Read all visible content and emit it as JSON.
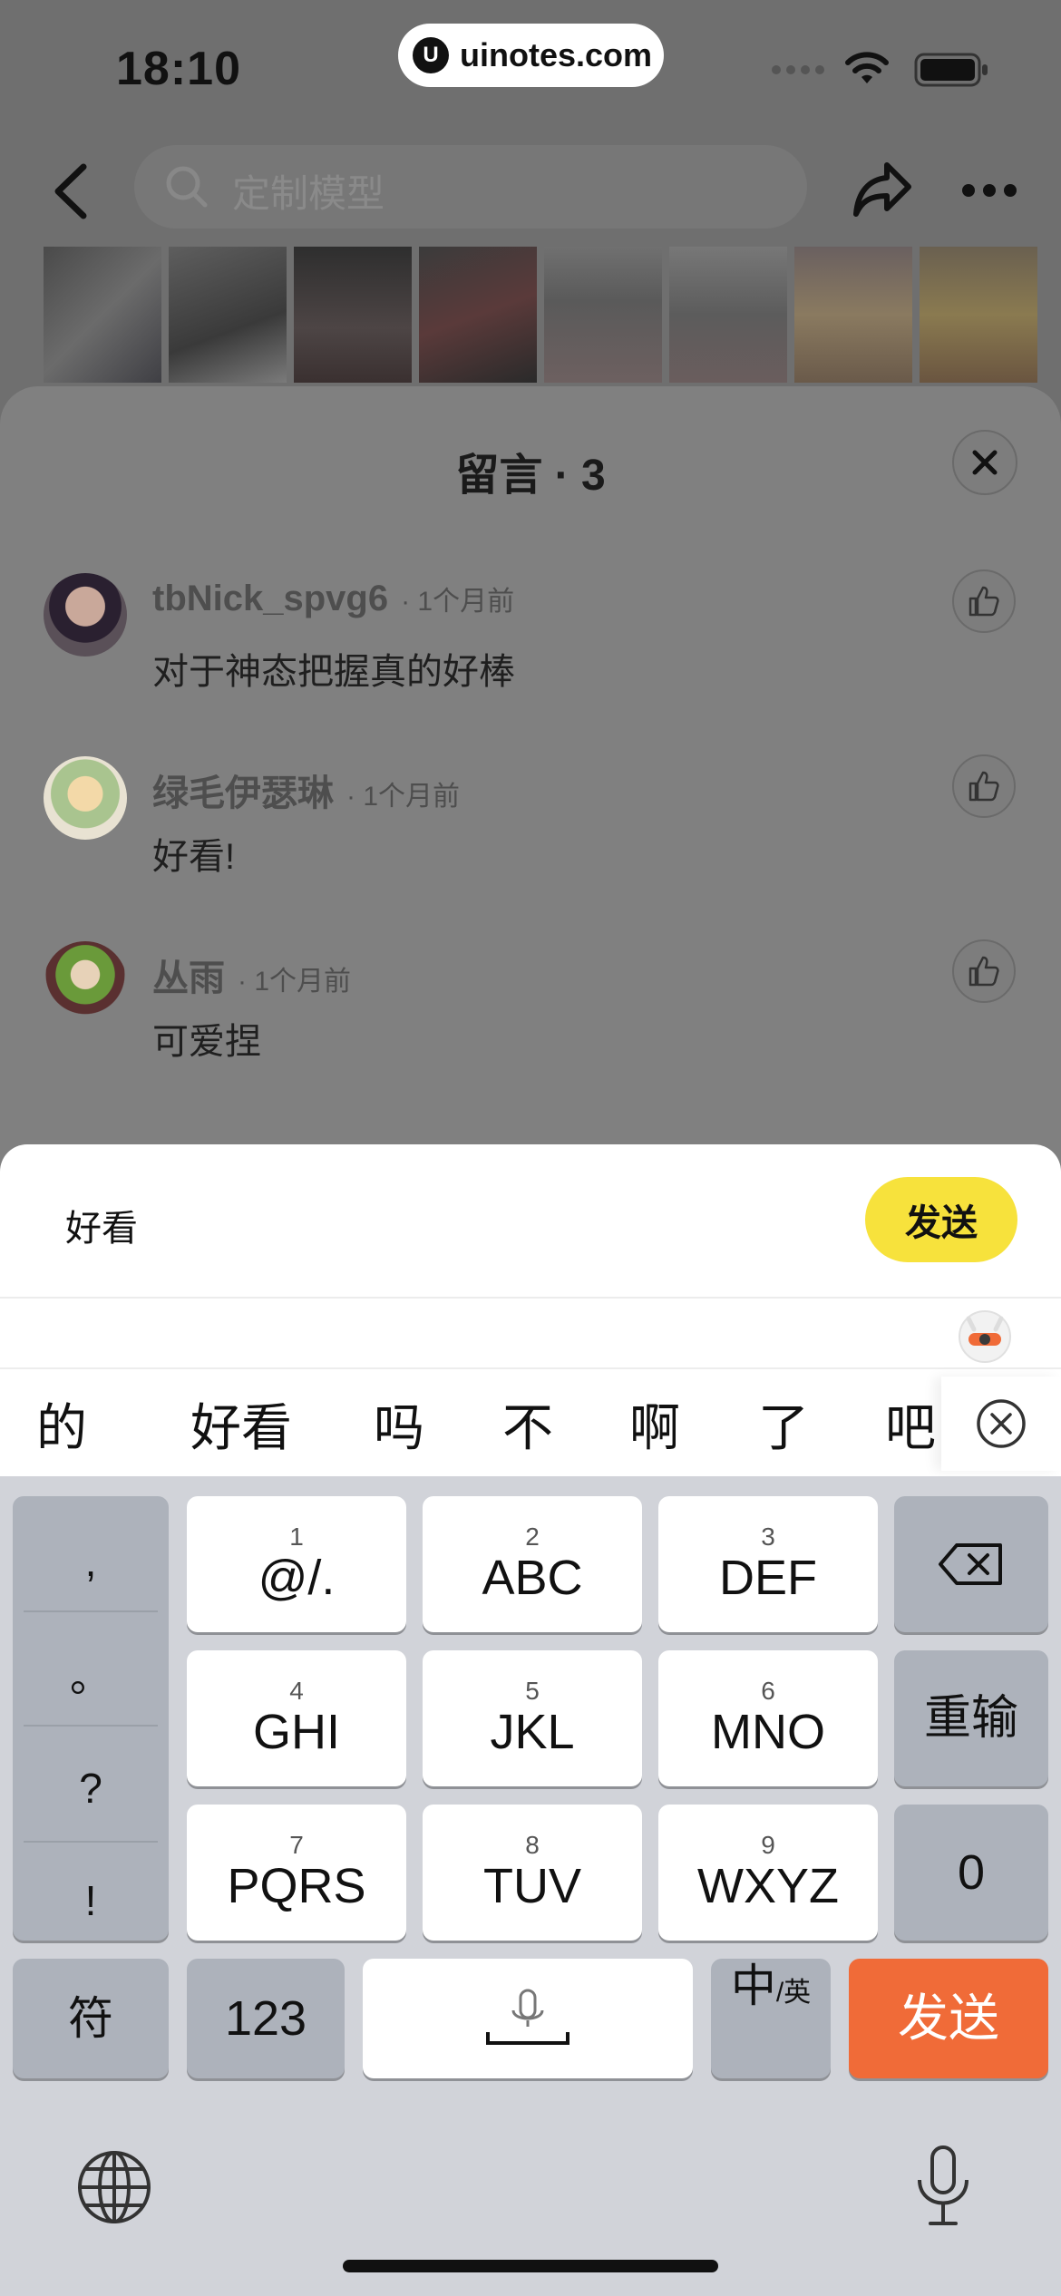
{
  "status_bar": {
    "time": "18:10",
    "site_label": "uinotes.com",
    "site_logo_letter": "U"
  },
  "nav": {
    "search_placeholder": "定制模型"
  },
  "comments_sheet": {
    "title": "留言 · 3",
    "comments": [
      {
        "user": "tbNick_spvg6",
        "time": "· 1个月前",
        "text": "对于神态把握真的好棒"
      },
      {
        "user": "绿毛伊瑟琳",
        "time": "· 1个月前",
        "text": "好看!"
      },
      {
        "user": "丛雨",
        "time": "· 1个月前",
        "text": "可爱捏"
      }
    ]
  },
  "input": {
    "value": "好看",
    "send_label": "发送"
  },
  "candidates": [
    "的",
    "好看",
    "吗",
    "不",
    "啊",
    "了",
    "吧"
  ],
  "keyboard": {
    "punctuation": [
      ",",
      "。",
      "?",
      "!"
    ],
    "keys": [
      {
        "num": "1",
        "label": "@/."
      },
      {
        "num": "2",
        "label": "ABC"
      },
      {
        "num": "3",
        "label": "DEF"
      },
      {
        "num": "4",
        "label": "GHI"
      },
      {
        "num": "5",
        "label": "JKL"
      },
      {
        "num": "6",
        "label": "MNO"
      },
      {
        "num": "7",
        "label": "PQRS"
      },
      {
        "num": "8",
        "label": "TUV"
      },
      {
        "num": "9",
        "label": "WXYZ"
      }
    ],
    "reenter_label": "重输",
    "zero_label": "0",
    "symbols_label": "符",
    "numbers_label": "123",
    "lang_main": "中",
    "lang_sub": "/英",
    "send_label": "发送"
  },
  "colors": {
    "send_pill": "#f7e23c",
    "keyboard_send": "#f06b38",
    "dim_overlay": "#6f6f6f"
  },
  "icons": [
    "back-icon",
    "search-icon",
    "share-icon",
    "more-icon",
    "close-icon",
    "thumbs-up-icon",
    "backspace-icon",
    "microphone-icon",
    "globe-icon"
  ]
}
